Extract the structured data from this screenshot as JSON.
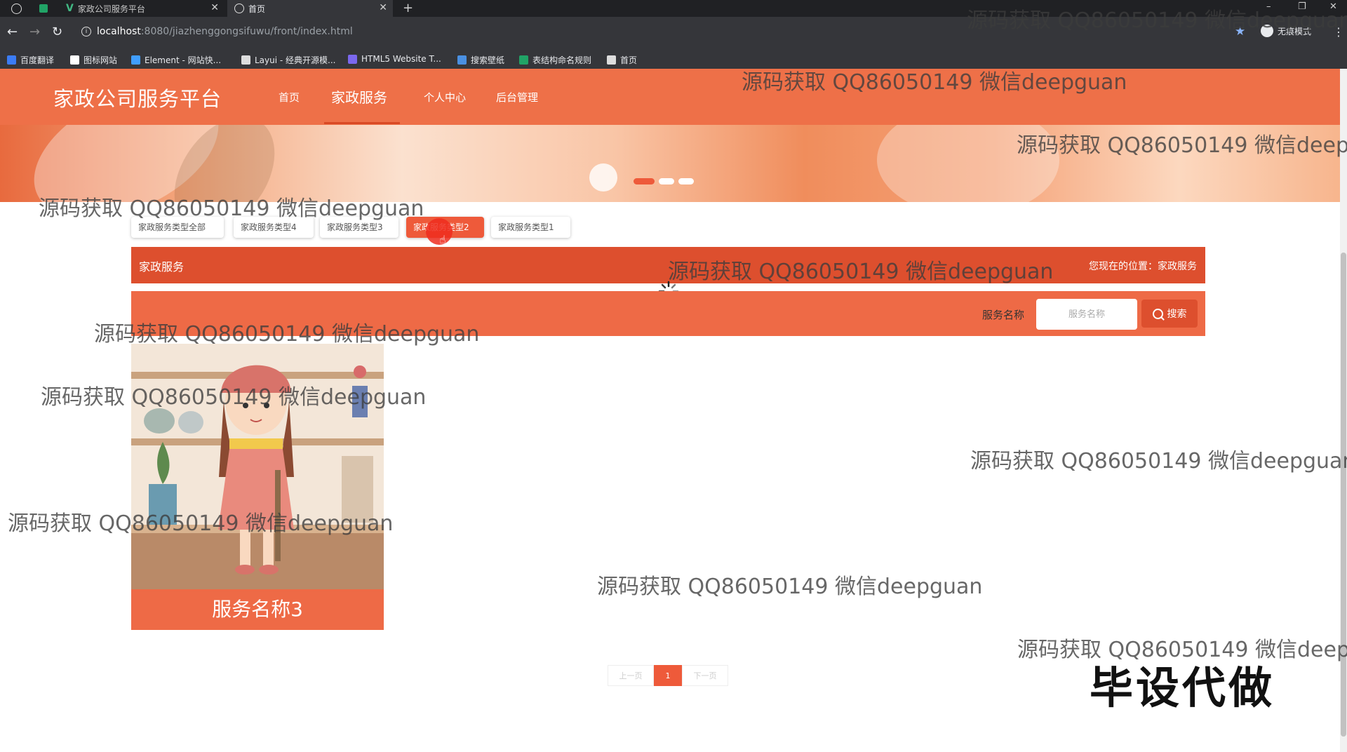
{
  "browser": {
    "tabs": [
      {
        "title": "家政公司服务平台"
      },
      {
        "title": "首页"
      }
    ],
    "new_tab": "+",
    "window_controls": [
      "–",
      "❐",
      "✕"
    ],
    "nav": {
      "back": "←",
      "forward": "→",
      "reload": "↻"
    },
    "url": {
      "host": "localhost",
      "path": ":8080/jiazhenggongsifuwu/front/index.html"
    },
    "incognito_label": "无痕模式",
    "bookmarks": [
      {
        "label": "百度翻译",
        "color": "#3b7cf5"
      },
      {
        "label": "图标网站",
        "color": "#ffffff"
      },
      {
        "label": "Element - 网站快...",
        "color": "#409eff"
      },
      {
        "label": "Layui - 经典开源模...",
        "color": "#dddddd"
      },
      {
        "label": "HTML5 Website T...",
        "color": "#7b68ee"
      },
      {
        "label": "搜索壁纸",
        "color": "#4a90e2"
      },
      {
        "label": "表结构命名规则",
        "color": "#21a366"
      },
      {
        "label": "首页",
        "color": "#dddddd"
      }
    ]
  },
  "site": {
    "brand": "家政公司服务平台",
    "nav": [
      {
        "label": "首页",
        "active": false
      },
      {
        "label": "家政服务",
        "active": true
      },
      {
        "label": "个人中心",
        "active": false
      },
      {
        "label": "后台管理",
        "active": false
      }
    ],
    "categories": [
      {
        "label": "家政服务类型全部",
        "active": false
      },
      {
        "label": "家政服务类型4",
        "active": false
      },
      {
        "label": "家政服务类型3",
        "active": false
      },
      {
        "label": "家政服务类型2",
        "active": true
      },
      {
        "label": "家政服务类型1",
        "active": false
      }
    ],
    "breadcrumb": {
      "title": "家政服务",
      "location": "您现在的位置：家政服务"
    },
    "search": {
      "label": "服务名称",
      "placeholder": "服务名称",
      "value": "",
      "button": "搜索"
    },
    "cards": [
      {
        "name": "服务名称3"
      }
    ],
    "pager": {
      "prev": "上一页",
      "current": "1",
      "next": "下一页"
    }
  },
  "overlay": {
    "watermark": "源码获取 QQ86050149 微信deepguan",
    "watermark_cut": "源码获取 QQ86050149 微信deepg",
    "promo": "毕设代做"
  },
  "colors": {
    "header": "#ee7048",
    "accent": "#ee5a3a",
    "crumbbar": "#dd4f2e"
  }
}
